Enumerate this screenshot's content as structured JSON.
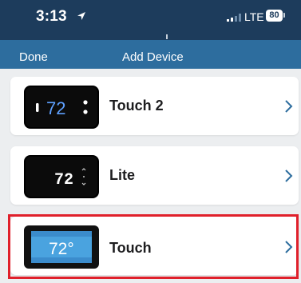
{
  "status_bar": {
    "time": "3:13",
    "carrier": "LTE",
    "battery": "80"
  },
  "navbar": {
    "done_label": "Done",
    "title": "Add Device"
  },
  "devices": [
    {
      "label": "Touch 2",
      "display_value": "72"
    },
    {
      "label": "Lite",
      "display_value": "72"
    },
    {
      "label": "Touch",
      "display_value": "72°"
    }
  ],
  "colors": {
    "status_bar": "#1d3c5c",
    "navbar": "#2d6d9e",
    "highlight": "#e0202b",
    "chevron": "#2d6d9e"
  }
}
